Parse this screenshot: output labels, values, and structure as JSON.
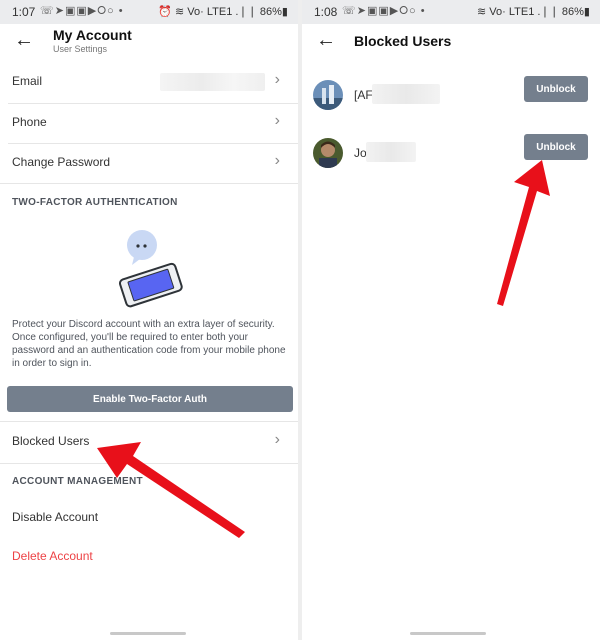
{
  "left": {
    "status": {
      "time": "1:07",
      "icons": "☏➤▣▣▶⭘○ •",
      "right": "⏰ ≋ Vo· LTE1 .❘❘ 86%▮"
    },
    "header": {
      "title": "My Account",
      "subtitle": "User Settings"
    },
    "rows": {
      "email": "Email",
      "phone": "Phone",
      "change_password": "Change Password"
    },
    "two_factor": {
      "heading": "TWO-FACTOR AUTHENTICATION",
      "description": "Protect your Discord account with an extra layer of security. Once configured, you'll be required to enter both your password and an authentication code from your mobile phone in order to sign in.",
      "button": "Enable Two-Factor Auth"
    },
    "blocked_users": "Blocked Users",
    "account_management": {
      "heading": "ACCOUNT MANAGEMENT",
      "disable": "Disable Account",
      "delete": "Delete Account"
    }
  },
  "right": {
    "status": {
      "time": "1:08",
      "icons": "☏➤▣▣▶⭘○ •",
      "right": "≋ Vo· LTE1 .❘❘ 86%▮"
    },
    "header": {
      "title": "Blocked Users"
    },
    "users": [
      {
        "name": "[AF",
        "button": "Unblock"
      },
      {
        "name": "Jo",
        "button": "Unblock"
      }
    ]
  },
  "colors": {
    "accent_button": "#747f8d",
    "danger": "#ed4245",
    "annotation_arrow": "#e8101a"
  },
  "icons": {
    "back": "back-arrow-icon",
    "chevron": "chevron-right-icon",
    "phone_illustration": "phone-chat-illustration"
  }
}
